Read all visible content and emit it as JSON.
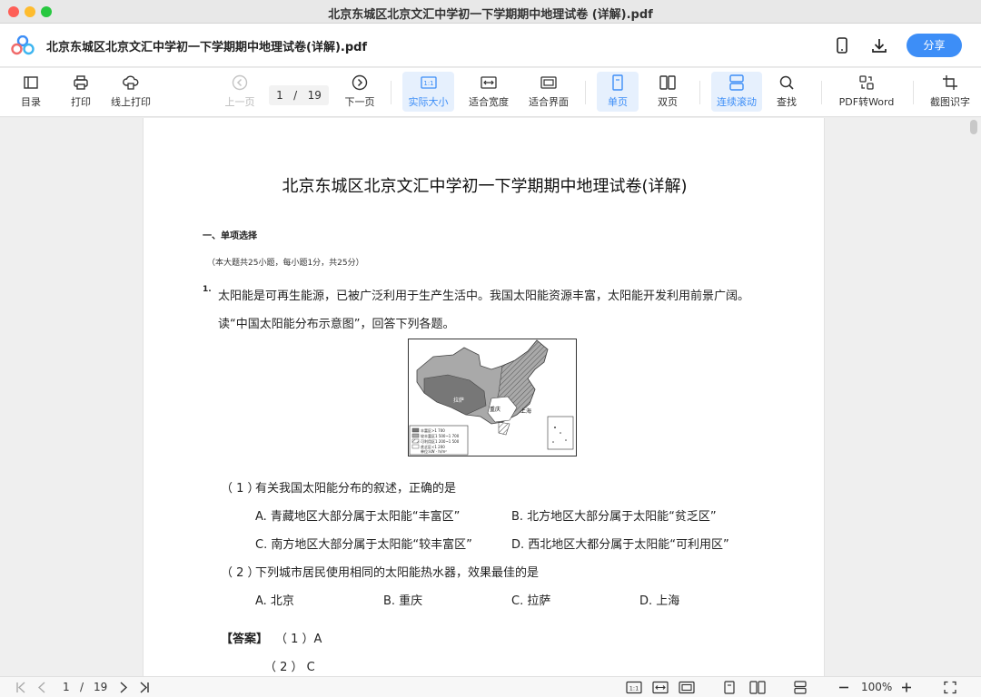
{
  "window": {
    "title": "北京东城区北京文汇中学初一下学期期中地理试卷 (详解).pdf"
  },
  "header": {
    "doc_name": "北京东城区北京文汇中学初一下学期期中地理试卷(详解).pdf",
    "share_label": "分享"
  },
  "toolbar": {
    "toc": "目录",
    "print": "打印",
    "online_print": "线上打印",
    "prev_page": "上一页",
    "page_current": "1",
    "page_sep": "/",
    "page_total": "19",
    "next_page": "下一页",
    "actual_size": "实际大小",
    "fit_width": "适合宽度",
    "fit_page": "适合界面",
    "single_page": "单页",
    "double_page": "双页",
    "continuous_scroll": "连续滚动",
    "find": "查找",
    "pdf_to_word": "PDF转Word",
    "screenshot_ocr": "截图识字"
  },
  "document": {
    "title": "北京东城区北京文汇中学初一下学期期中地理试卷(详解)",
    "section": "一、单项选择",
    "section_note": "（本大题共25小题，每小题1分，共25分）",
    "q1_number": "1.",
    "q1_line1": "太阳能是可再生能源，已被广泛利用于生产生活中。我国太阳能资源丰富，太阳能开发利用前景广阔。",
    "q1_line2": "读“中国太阳能分布示意图”，回答下列各题。",
    "map": {
      "city_lhasa": "拉萨",
      "city_chongqing": "重庆",
      "city_shanghai": "上海",
      "legend": [
        "丰富区>1 700",
        "较丰富区1 500~1 700",
        "可利用区1 200~1 500",
        "贫乏区<1 200",
        "单位:kW · h/m²"
      ]
    },
    "sub1_num": "（ 1 ）",
    "sub1_text": "有关我国太阳能分布的叙述，正确的是",
    "opt_a1": "A. 青藏地区大部分属于太阳能“丰富区”",
    "opt_b1": "B. 北方地区大部分属于太阳能“贫乏区”",
    "opt_c1": "C. 南方地区大部分属于太阳能“较丰富区”",
    "opt_d1": "D. 西北地区大都分属于太阳能“可利用区”",
    "sub2_num": "（ 2 ）",
    "sub2_text": "下列城市居民使用相同的太阳能热水器，效果最佳的是",
    "opt_a2": "A. 北京",
    "opt_b2": "B. 重庆",
    "opt_c2": "C. 拉萨",
    "opt_d2": "D. 上海",
    "answer_label": "【答案】",
    "answer_1": "（ 1 ）A",
    "answer_2": "（ 2 ） C"
  },
  "statusbar": {
    "page_current": "1",
    "page_sep": "/",
    "page_total": "19",
    "zoom": "100%"
  },
  "colors": {
    "accent": "#3d8ef7",
    "active_bg": "#e6f0fd"
  }
}
